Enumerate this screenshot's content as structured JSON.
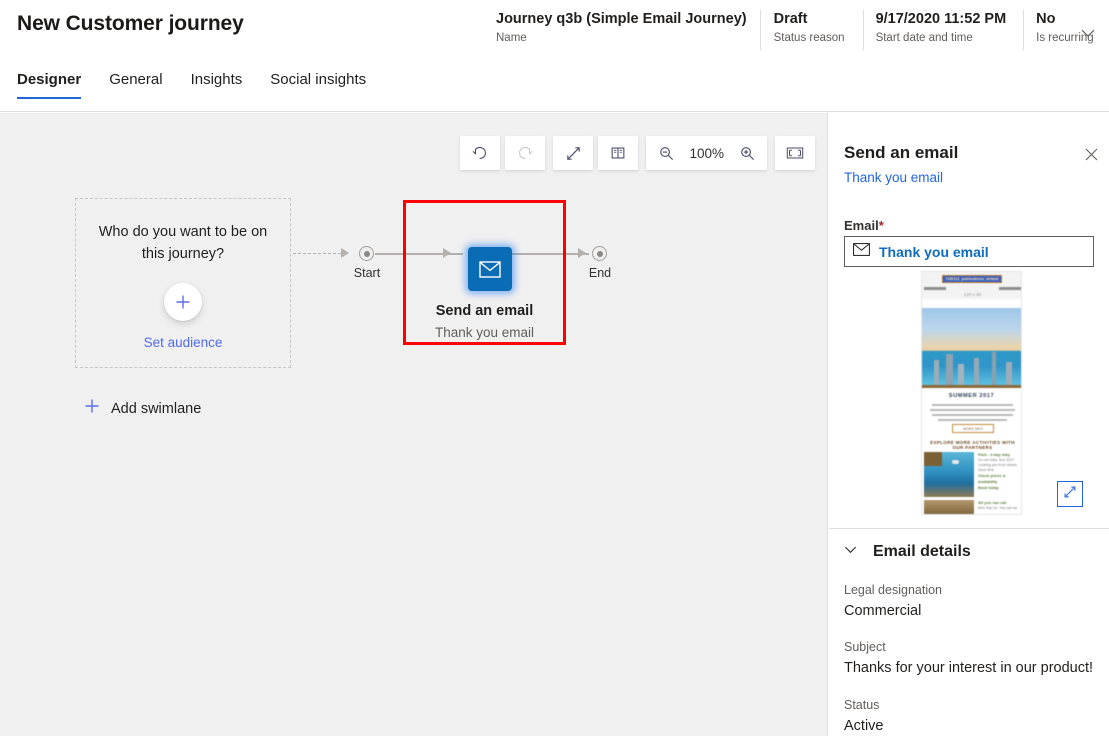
{
  "header": {
    "page_title": "New Customer journey",
    "fields": [
      {
        "value": "Journey q3b (Simple Email Journey)",
        "label": "Name"
      },
      {
        "value": "Draft",
        "label": "Status reason"
      },
      {
        "value": "9/17/2020 11:52 PM",
        "label": "Start date and time"
      },
      {
        "value": "No",
        "label": "Is recurring"
      }
    ],
    "chevron_icon": "chevron-down-icon"
  },
  "tabs": [
    {
      "label": "Designer",
      "active": true
    },
    {
      "label": "General",
      "active": false
    },
    {
      "label": "Insights",
      "active": false
    },
    {
      "label": "Social insights",
      "active": false
    }
  ],
  "toolbar": {
    "undo_icon": "undo-icon",
    "redo_icon": "redo-icon",
    "expand_icon": "expand-diagonal-icon",
    "minimap_icon": "minimap-icon",
    "zoom_out_icon": "zoom-out-icon",
    "zoom_level": "100%",
    "zoom_in_icon": "zoom-in-icon",
    "fit_icon": "fit-to-screen-icon"
  },
  "canvas": {
    "swimlane": {
      "question": "Who do you want to be on this journey?",
      "add_icon": "plus-icon",
      "action_label": "Set audience"
    },
    "start_label": "Start",
    "end_label": "End",
    "tile": {
      "icon": "envelope-icon",
      "title": "Send an email",
      "subtitle": "Thank you email",
      "selection_color": "#ff0000",
      "tile_color": "#0a6cb5"
    },
    "add_swimlane": {
      "icon": "plus-icon",
      "label": "Add swimlane"
    }
  },
  "panel": {
    "title": "Send an email",
    "subtitle_link": "Thank you email",
    "close_icon": "close-icon",
    "email_field": {
      "label": "Email",
      "required_marker": "*",
      "icon": "envelope-icon",
      "value": "Thank you email"
    },
    "preview": {
      "top_bar_text": "7180111_publications_default",
      "dimension_text": "120 x 60",
      "headline": "SUMMER 2017",
      "cta_text": "MORE INFO",
      "section_title": "EXPLORE MORE ACTIVITIES WITH OUR PARTNERS",
      "card1_title": "Park - 3-day stay",
      "card1_line1": "Do not miss, Sun 2017",
      "card1_line2": "Looking you from dream, Save time",
      "card1_line3": "Check prices & availability",
      "card1_line4": "Book today",
      "card2_title": "All you can eat",
      "card2_line1": "Mon Sep 01, You can be"
    },
    "expand_preview_icon": "expand-diagonal-icon",
    "details": {
      "collapse_icon": "chevron-down-icon",
      "heading": "Email details",
      "rows": [
        {
          "label": "Legal designation",
          "value": "Commercial"
        },
        {
          "label": "Subject",
          "value": "Thanks for your interest in our product!"
        },
        {
          "label": "Status",
          "value": "Active"
        }
      ]
    }
  }
}
